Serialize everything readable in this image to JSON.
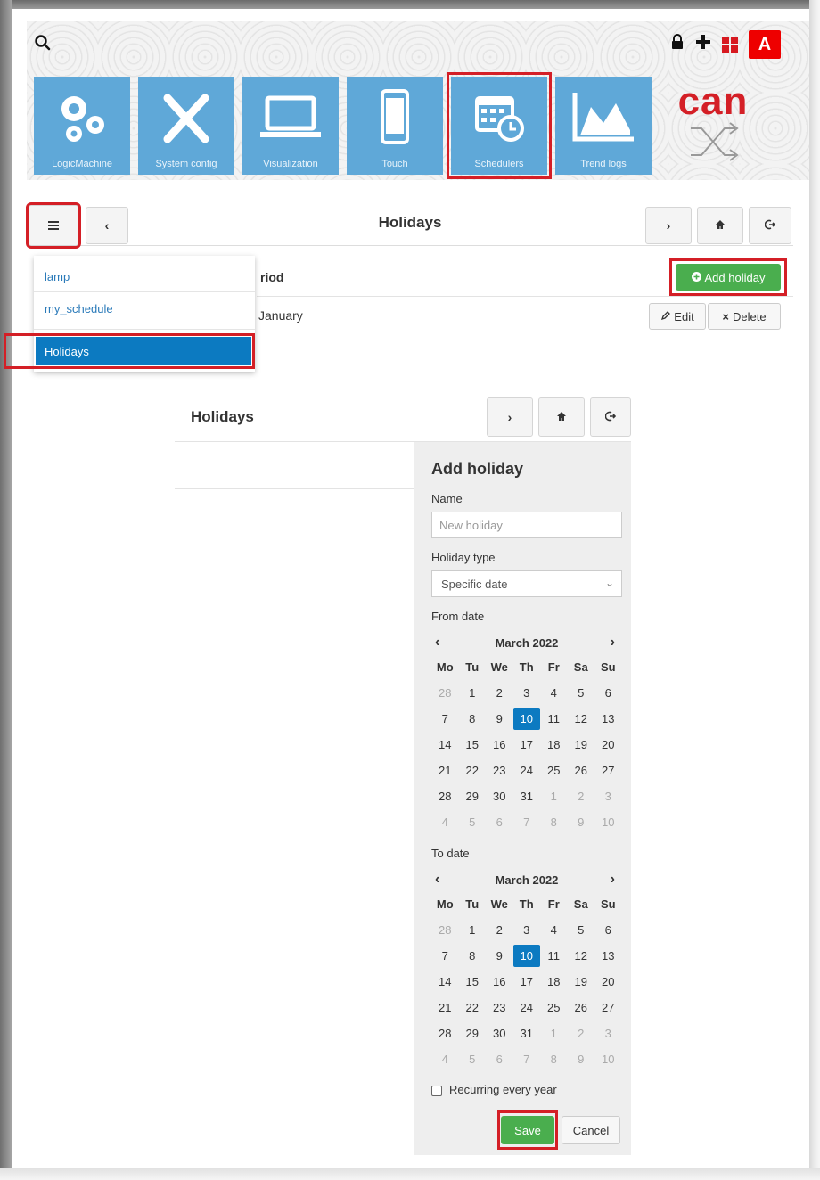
{
  "header": {
    "apps": [
      {
        "label": "LogicMachine",
        "icon": "gears-icon"
      },
      {
        "label": "System config",
        "icon": "tools-icon"
      },
      {
        "label": "Visualization",
        "icon": "laptop-icon"
      },
      {
        "label": "Touch",
        "icon": "phone-icon"
      },
      {
        "label": "Schedulers",
        "icon": "calendar-clock-icon"
      },
      {
        "label": "Trend logs",
        "icon": "area-chart-icon"
      }
    ],
    "brand_word": "can",
    "avatar_letter": "A"
  },
  "panel1": {
    "title": "Holidays",
    "column_header": "riod",
    "row_text": "January",
    "add_button": "Add holiday",
    "edit_button": "Edit",
    "delete_button": "Delete",
    "menu_items": [
      "lamp",
      "my_schedule",
      "Holidays"
    ]
  },
  "panel2": {
    "title": "Holidays",
    "form_title": "Add holiday",
    "name_label": "Name",
    "name_placeholder": "New holiday",
    "type_label": "Holiday type",
    "type_value": "Specific date",
    "from_label": "From date",
    "to_label": "To date",
    "recurring_label": "Recurring every year",
    "save_label": "Save",
    "cancel_label": "Cancel"
  },
  "calendar": {
    "month": "March 2022",
    "weekdays": [
      "Mo",
      "Tu",
      "We",
      "Th",
      "Fr",
      "Sa",
      "Su"
    ],
    "days": [
      [
        "28",
        "1",
        "2",
        "3",
        "4",
        "5",
        "6"
      ],
      [
        "7",
        "8",
        "9",
        "10",
        "11",
        "12",
        "13"
      ],
      [
        "14",
        "15",
        "16",
        "17",
        "18",
        "19",
        "20"
      ],
      [
        "21",
        "22",
        "23",
        "24",
        "25",
        "26",
        "27"
      ],
      [
        "28",
        "29",
        "30",
        "31",
        "1",
        "2",
        "3"
      ],
      [
        "4",
        "5",
        "6",
        "7",
        "8",
        "9",
        "10"
      ]
    ],
    "selected_day": "10"
  },
  "colors": {
    "accent_red": "#d41f26",
    "tile_blue": "#5fa8d8",
    "save_green": "#4aae4e",
    "selected_blue": "#0c7ac1"
  }
}
